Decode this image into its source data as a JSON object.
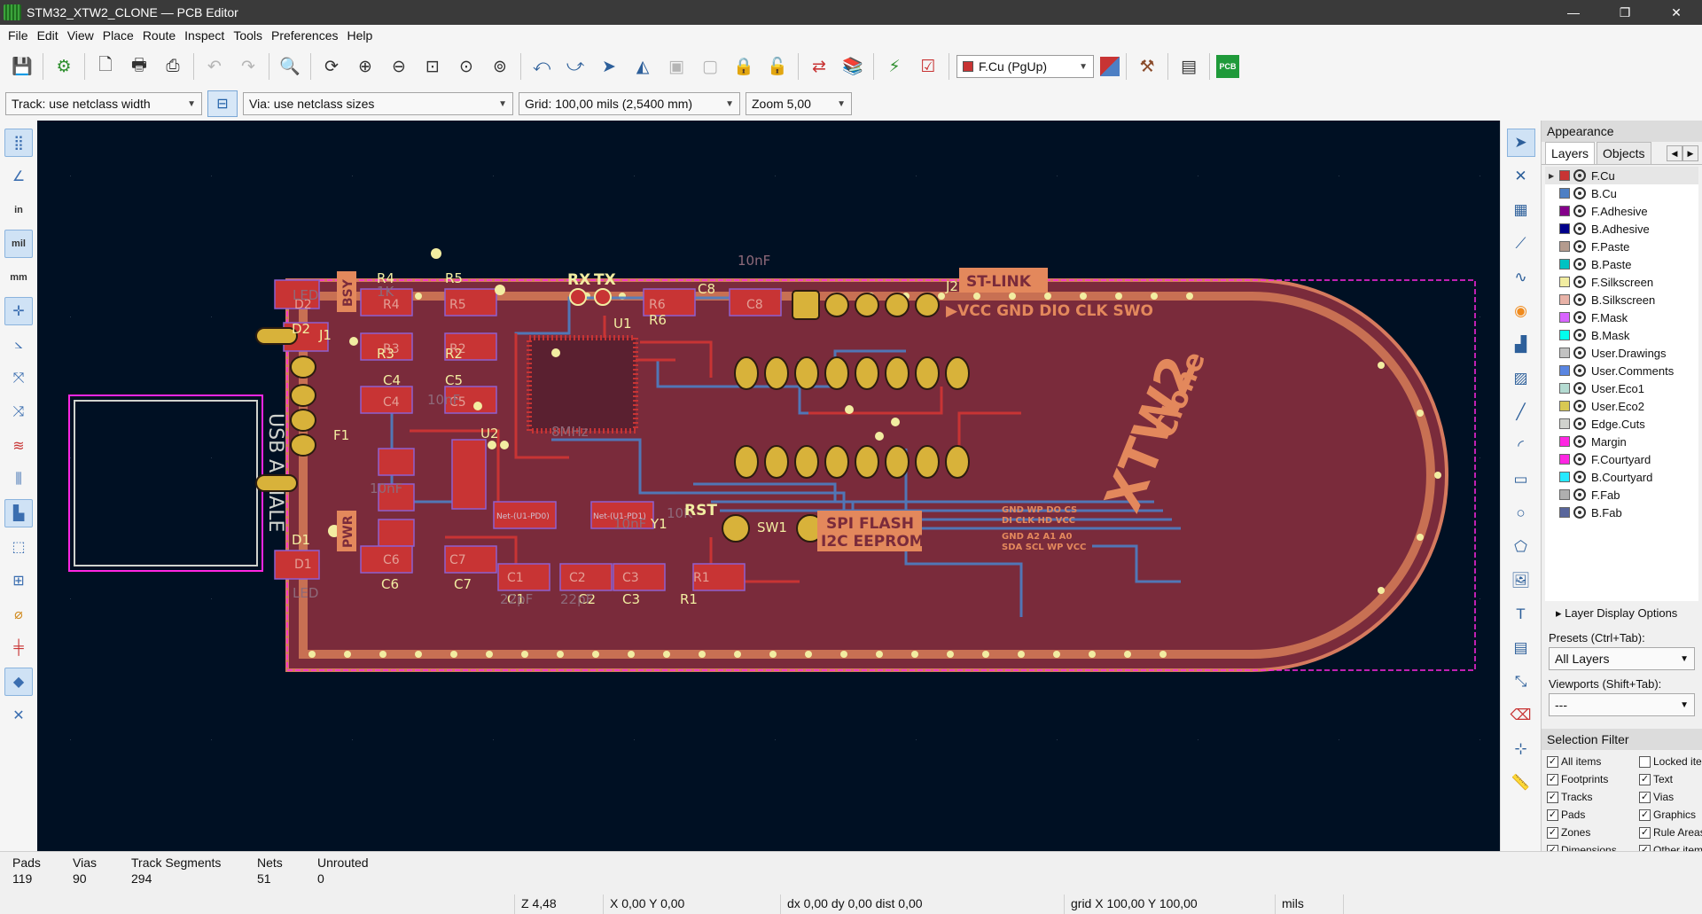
{
  "window": {
    "title": "STM32_XTW2_CLONE — PCB Editor",
    "minimize": "—",
    "restore": "❐",
    "close": "✕"
  },
  "menu": [
    "File",
    "Edit",
    "View",
    "Place",
    "Route",
    "Inspect",
    "Tools",
    "Preferences",
    "Help"
  ],
  "toolbar": {
    "layer_selector": "F.Cu (PgUp)"
  },
  "toolbar2": {
    "track": "Track: use netclass width",
    "via": "Via: use netclass sizes",
    "grid": "Grid: 100,00 mils (2,5400 mm)",
    "zoom": "Zoom 5,00"
  },
  "left_toolbar": {
    "in": "in",
    "mil": "mil",
    "mm": "mm"
  },
  "pcb": {
    "usb_label": "USB A MALE",
    "st_link": "ST-LINK",
    "st_link_pins": "▶VCC GND DIO CLK SWO",
    "spi_flash": "SPI FLASH",
    "i2c_eeprom": "I2C EEPROM",
    "eeprom_pins_top": "GND WP DO CS",
    "eeprom_pins_mid": "DI CLK HD VCC",
    "eeprom_pins_a": "GND A2 A1 A0",
    "eeprom_pins_b": "SDA SCL WP VCC",
    "xtw2": "XTW2",
    "clone": "Clone",
    "rx": "RX",
    "tx": "TX",
    "rst": "RST",
    "bsy": "BSY",
    "pwr": "PWR",
    "refs": [
      "R4",
      "R5",
      "J1",
      "D2",
      "D1",
      "R3",
      "R2",
      "C4",
      "C5",
      "F1",
      "U2",
      "C6",
      "C7",
      "C8",
      "U1",
      "R6",
      "J2",
      "Y1",
      "SW1",
      "C1",
      "C2",
      "C3",
      "R1",
      "D2",
      "R4",
      "R5",
      "R3",
      "R2",
      "C4",
      "C5",
      "C6",
      "C7",
      "C1",
      "C2",
      "C3",
      "R1",
      "R6",
      "C8",
      "D1"
    ],
    "net_labels": [
      "Net-(U1-PD0)",
      "Net-(U1-PD1)"
    ],
    "vals": [
      "10nF",
      "10nF",
      "10nF",
      "10nF",
      "8MHz",
      "22pF",
      "22pF",
      "LED",
      "LED",
      "1K",
      "10K"
    ]
  },
  "appearance": {
    "title": "Appearance",
    "tabs": [
      "Layers",
      "Objects"
    ],
    "layers": [
      {
        "name": "F.Cu",
        "color": "#c83434"
      },
      {
        "name": "B.Cu",
        "color": "#4d7fc4"
      },
      {
        "name": "F.Adhesive",
        "color": "#84008a"
      },
      {
        "name": "B.Adhesive",
        "color": "#00008a"
      },
      {
        "name": "F.Paste",
        "color": "#b49b8e"
      },
      {
        "name": "B.Paste",
        "color": "#00c2c2"
      },
      {
        "name": "F.Silkscreen",
        "color": "#f2eda1"
      },
      {
        "name": "B.Silkscreen",
        "color": "#e8b2a7"
      },
      {
        "name": "F.Mask",
        "color": "#d864ff"
      },
      {
        "name": "B.Mask",
        "color": "#02ffee"
      },
      {
        "name": "User.Drawings",
        "color": "#c2c2c2"
      },
      {
        "name": "User.Comments",
        "color": "#5985e1"
      },
      {
        "name": "User.Eco1",
        "color": "#b4dbd2"
      },
      {
        "name": "User.Eco2",
        "color": "#d8c852"
      },
      {
        "name": "Edge.Cuts",
        "color": "#d0d2cd"
      },
      {
        "name": "Margin",
        "color": "#ff26e2"
      },
      {
        "name": "F.Courtyard",
        "color": "#ff26e2"
      },
      {
        "name": "B.Courtyard",
        "color": "#26e9ff"
      },
      {
        "name": "F.Fab",
        "color": "#afafaf"
      },
      {
        "name": "B.Fab",
        "color": "#58659b"
      }
    ],
    "layer_display_options": "Layer Display Options",
    "presets_label": "Presets (Ctrl+Tab):",
    "presets_value": "All Layers",
    "viewports_label": "Viewports (Shift+Tab):",
    "viewports_value": "---"
  },
  "selection_filter": {
    "title": "Selection Filter",
    "items": [
      {
        "label": "All items",
        "checked": true
      },
      {
        "label": "Locked items",
        "checked": false
      },
      {
        "label": "Footprints",
        "checked": true
      },
      {
        "label": "Text",
        "checked": true
      },
      {
        "label": "Tracks",
        "checked": true
      },
      {
        "label": "Vias",
        "checked": true
      },
      {
        "label": "Pads",
        "checked": true
      },
      {
        "label": "Graphics",
        "checked": true
      },
      {
        "label": "Zones",
        "checked": true
      },
      {
        "label": "Rule Areas",
        "checked": true
      },
      {
        "label": "Dimensions",
        "checked": true
      },
      {
        "label": "Other items",
        "checked": true
      }
    ]
  },
  "status": {
    "pads_label": "Pads",
    "pads": "119",
    "vias_label": "Vias",
    "vias": "90",
    "tracks_label": "Track Segments",
    "tracks": "294",
    "nets_label": "Nets",
    "nets": "51",
    "unrouted_label": "Unrouted",
    "unrouted": "0",
    "zoom": "Z 4,48",
    "xy": "X 0,00  Y 0,00",
    "dxdy": "dx 0,00  dy 0,00  dist 0,00",
    "grid": "grid X 100,00  Y 100,00",
    "units": "mils"
  }
}
